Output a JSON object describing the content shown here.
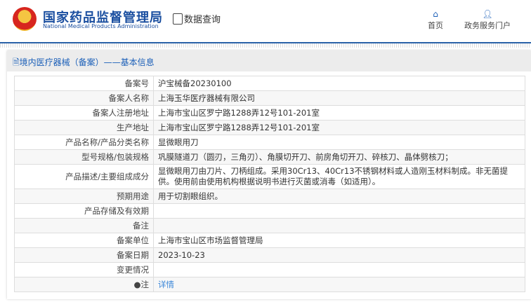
{
  "header": {
    "logo_cn": "国家药品监督管理局",
    "logo_en": "National Medical Products Administration",
    "query": "数据查询",
    "nav": [
      {
        "label": "首页",
        "icon": "home-icon"
      },
      {
        "label": "政务服务门户",
        "icon": "user-icon"
      }
    ]
  },
  "panel": {
    "title": "境内医疗器械（备案）——基本信息"
  },
  "rows": [
    {
      "label": "备案号",
      "value": "沪宝械备20230100"
    },
    {
      "label": "备案人名称",
      "value": "上海玉华医疗器械有限公司"
    },
    {
      "label": "备案人注册地址",
      "value": "上海市宝山区罗宁路1288弄12号101-201室"
    },
    {
      "label": "生产地址",
      "value": "上海市宝山区罗宁路1288弄12号101-201室"
    },
    {
      "label": "产品名称/产品分类名称",
      "value": "显微眼用刀"
    },
    {
      "label": "型号规格/包装规格",
      "value": "巩膜隧道刀（圆刃，三角刃）、角膜切开刀、前房角切开刀、碎核刀、晶体劈核刀；"
    },
    {
      "label": "产品描述/主要组成成分",
      "value": "显微眼用刀由刀片、刀柄组成。采用30Cr13、40Cr13不锈钢材料或人造刚玉材料制成。非无菌提供。使用前由使用机构根据说明书进行灭菌或消毒（如适用）。"
    },
    {
      "label": "预期用途",
      "value": "用于切割眼组织。"
    },
    {
      "label": "产品存储及有效期",
      "value": ""
    },
    {
      "label": "备注",
      "value": ""
    },
    {
      "label": "备案单位",
      "value": "上海市宝山区市场监督管理局"
    },
    {
      "label": "备案日期",
      "value": "2023-10-23"
    },
    {
      "label": "变更情况",
      "value": ""
    }
  ],
  "note": {
    "label": "注",
    "link": "详情"
  }
}
